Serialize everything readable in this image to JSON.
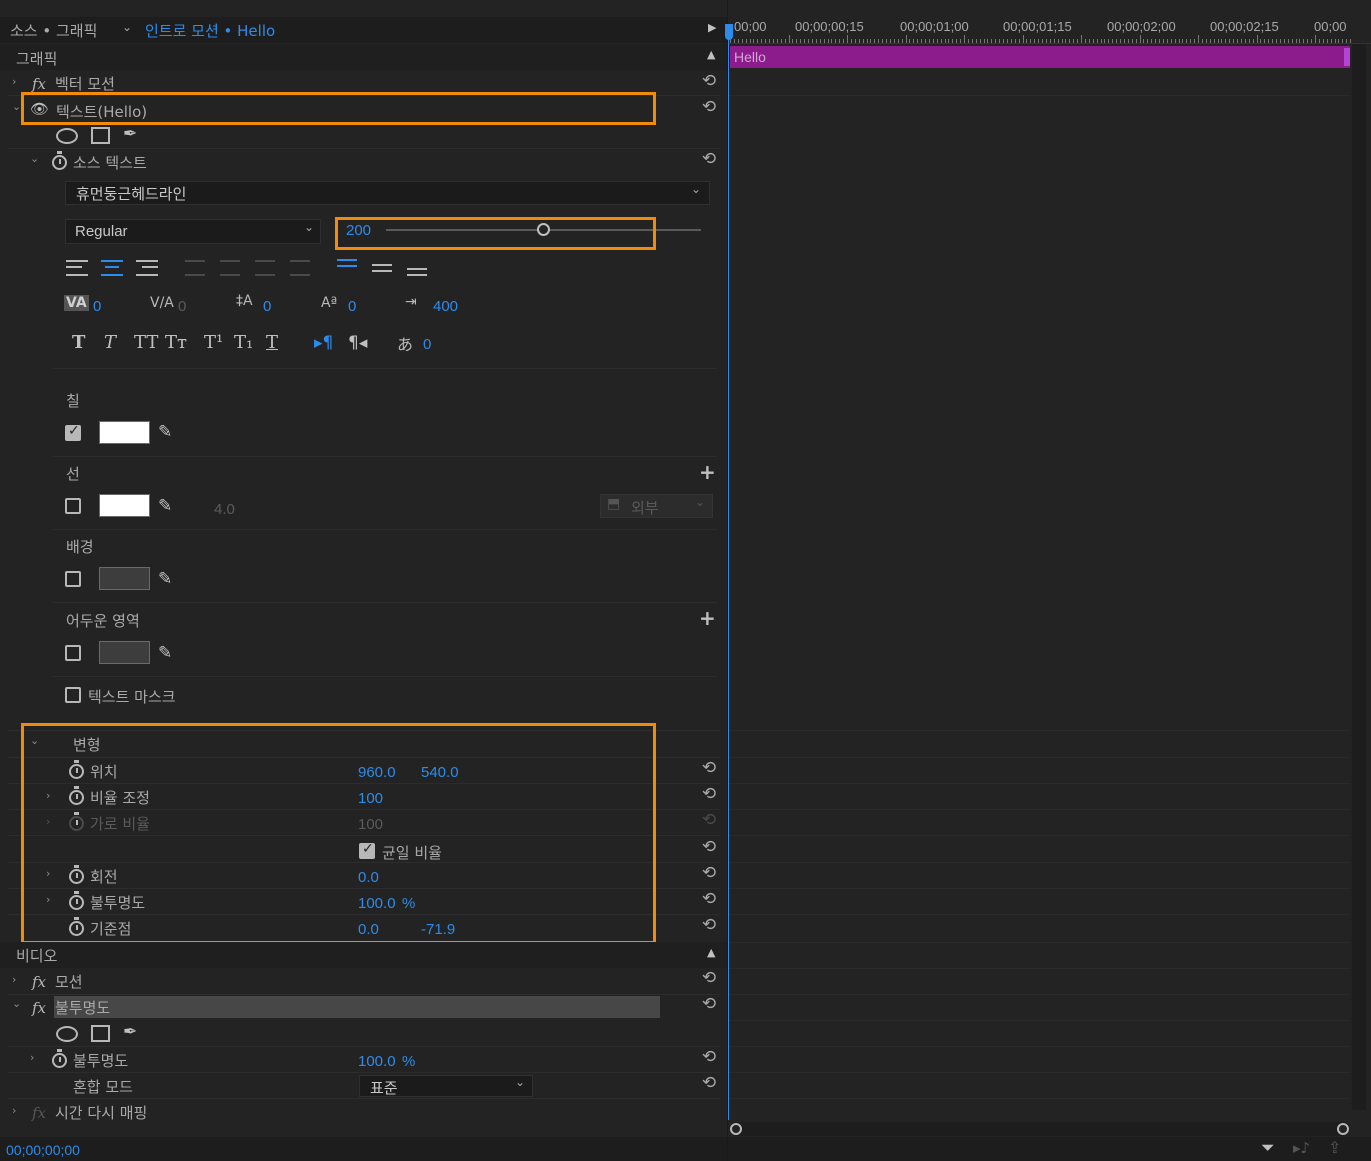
{
  "header": {
    "source": "소스 • 그래픽",
    "sequence": "인트로 모션 • Hello"
  },
  "timeline": {
    "timecodes": [
      "00;00",
      "00;00;00;15",
      "00;00;01;00",
      "00;00;01;15",
      "00;00;02;00",
      "00;00;02;15",
      "00;00"
    ],
    "clip_label": "Hello",
    "clip_color": "#8c1b8c",
    "playhead_color": "#2d8ceb"
  },
  "graphic": {
    "section_label": "그래픽",
    "vector_motion": "벡터 모션",
    "text_layer": "텍스트(Hello)",
    "source_text": "소스 텍스트",
    "font_name": "휴먼둥근헤드라인",
    "font_style": "Regular",
    "font_size": "200",
    "font_size_slider_fraction": 0.5,
    "kerning": "0",
    "tracking": "0",
    "leading": "0",
    "baseline": "0",
    "tab_width": "400",
    "tsume": "0",
    "fill_label": "칠",
    "stroke_label": "선",
    "stroke_width": "4.0",
    "stroke_type": "외부",
    "background_label": "배경",
    "shadow_label": "어두운 영역",
    "text_mask_label": "텍스트 마스크",
    "transform": {
      "label": "변형",
      "position_label": "위치",
      "position_x": "960.0",
      "position_y": "540.0",
      "scale_label": "비율 조정",
      "scale": "100",
      "scale_width_label": "가로 비율",
      "scale_width": "100",
      "uniform_label": "균일 비율",
      "rotation_label": "회전",
      "rotation": "0.0",
      "opacity_label": "불투명도",
      "opacity": "100.0",
      "opacity_unit": "%",
      "anchor_label": "기준점",
      "anchor_x": "0.0",
      "anchor_y": "-71.9"
    }
  },
  "video": {
    "section_label": "비디오",
    "motion": "모션",
    "opacity_effect": "불투명도",
    "opacity_label": "불투명도",
    "opacity_value": "100.0",
    "opacity_unit": "%",
    "blend_label": "혼합 모드",
    "blend_value": "표준",
    "time_remap": "시간 다시 매핑"
  },
  "footer": {
    "timecode": "00;00;00;00"
  },
  "icons": {
    "reset": "reset-icon",
    "stopwatch": "stopwatch-icon",
    "eyedropper": "eyedropper-icon",
    "plus": "plus-icon",
    "filter": "filter-icon"
  }
}
